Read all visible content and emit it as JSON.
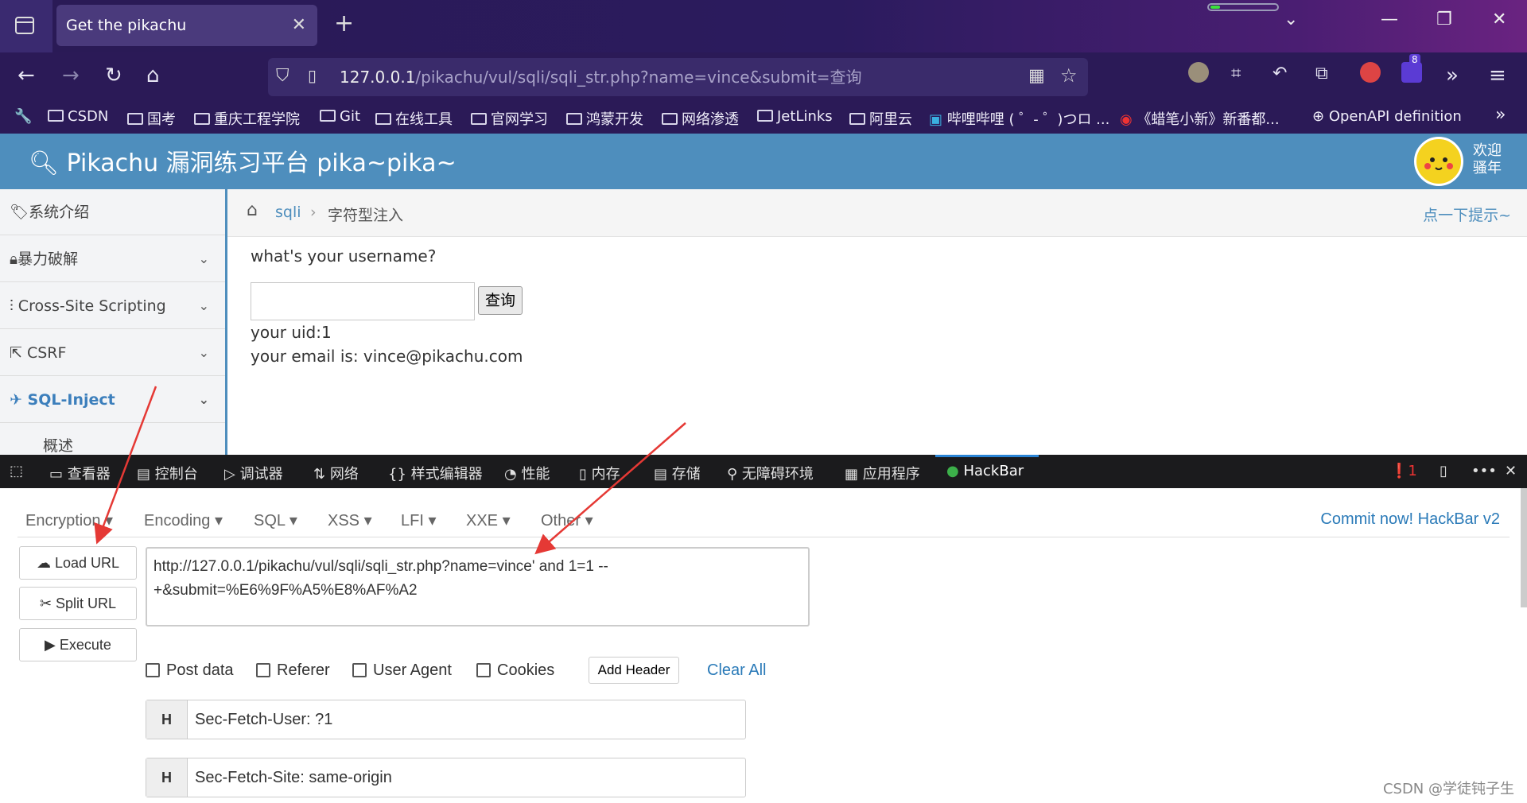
{
  "browser": {
    "tab_title": "Get the pikachu",
    "url_host": "127.0.0.1",
    "url_path": "/pikachu/vul/sqli/sqli_str.php?name=vince&submit=查询",
    "extension_badge": "8",
    "bookmarks": [
      "CSDN",
      "国考",
      "重庆工程学院",
      "Git",
      "在线工具",
      "官网学习",
      "鸿蒙开发",
      "网络渗透",
      "JetLinks",
      "阿里云",
      "哔哩哔哩 ( ゜- ゜)つロ ...",
      "《蜡笔小新》新番都...",
      "OpenAPI definition"
    ]
  },
  "page": {
    "logo_text": "Pikachu 漏洞练习平台 pika~pika~",
    "welcome": [
      "欢迎",
      "骚年"
    ],
    "sidebar": [
      "系统介绍",
      "暴力破解",
      "Cross-Site Scripting",
      "CSRF",
      "SQL-Inject",
      "概述"
    ],
    "breadcrumb_home": "sqli",
    "breadcrumb_current": "字符型注入",
    "hint_link": "点一下提示~",
    "prompt": "what's your username?",
    "query_button": "查询",
    "result_uid": "your uid:1",
    "result_email": "your email is: vince@pikachu.com"
  },
  "devtools": {
    "tabs": [
      "查看器",
      "控制台",
      "调试器",
      "网络",
      "样式编辑器",
      "性能",
      "内存",
      "存储",
      "无障碍环境",
      "应用程序",
      "HackBar"
    ],
    "error_count": "1"
  },
  "hackbar": {
    "menus": [
      "Encryption",
      "Encoding",
      "SQL",
      "XSS",
      "LFI",
      "XXE",
      "Other"
    ],
    "commit_link": "Commit now! HackBar v2",
    "load_url": "Load URL",
    "split_url": "Split URL",
    "execute": "Execute",
    "url_value": "http://127.0.0.1/pikachu/vul/sqli/sqli_str.php?name=vince' and 1=1 --\n+&submit=%E6%9F%A5%E8%AF%A2",
    "options": [
      "Post data",
      "Referer",
      "User Agent",
      "Cookies"
    ],
    "add_header": "Add Header",
    "clear_all": "Clear All",
    "headers": [
      {
        "key": "H",
        "value": "Sec-Fetch-User: ?1"
      },
      {
        "key": "H",
        "value": "Sec-Fetch-Site: same-origin"
      }
    ]
  },
  "watermark": "CSDN @学徒钝子生",
  "colors": {
    "header": "#4e8ebd",
    "chrome": "#2b1a57",
    "link": "#2a7ab8"
  }
}
